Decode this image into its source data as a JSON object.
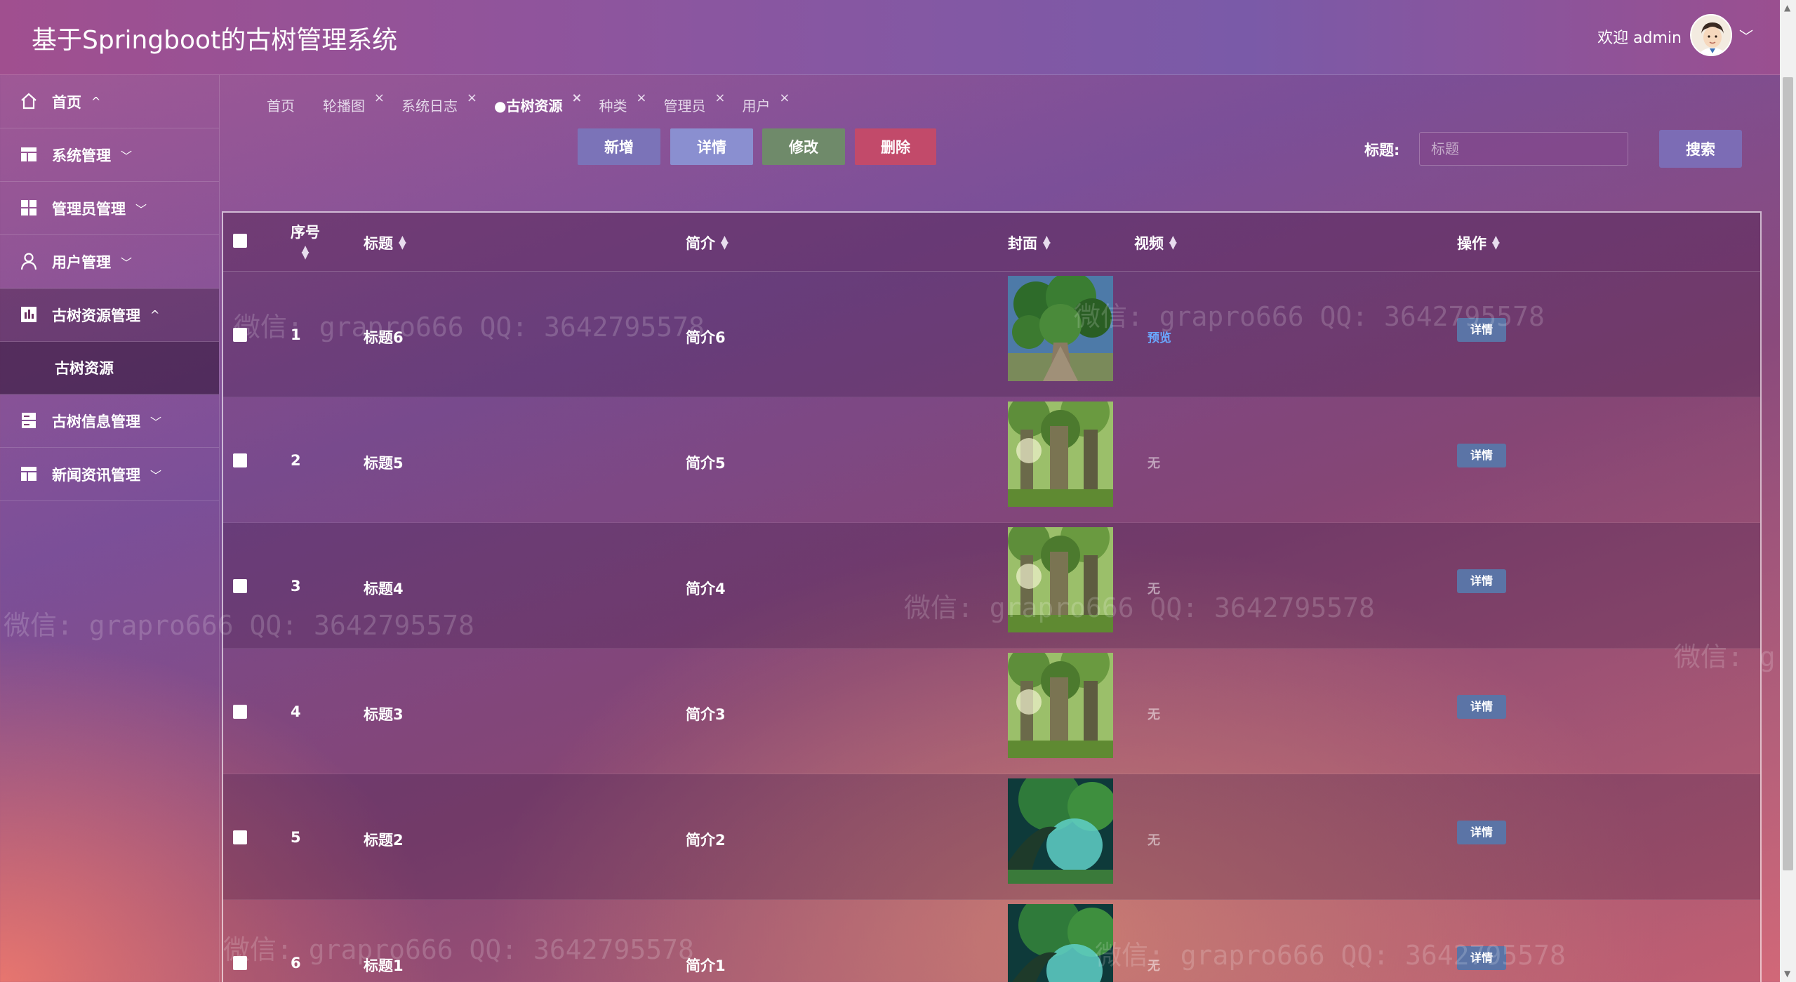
{
  "header": {
    "title": "基于Springboot的古树管理系统",
    "welcome": "欢迎 admin",
    "menu_arrow": "﹀"
  },
  "sidebar": {
    "items": [
      {
        "label": "首页",
        "icon": "home-icon",
        "arrow": "^"
      },
      {
        "label": "系统管理",
        "icon": "table-icon",
        "arrow": "﹀"
      },
      {
        "label": "管理员管理",
        "icon": "grid-icon",
        "arrow": "﹀"
      },
      {
        "label": "用户管理",
        "icon": "user-icon",
        "arrow": "﹀"
      },
      {
        "label": "古树资源管理",
        "icon": "chart-icon",
        "arrow": "^"
      },
      {
        "label": "古树信息管理",
        "icon": "server-icon",
        "arrow": "﹀"
      },
      {
        "label": "新闻资讯管理",
        "icon": "table-icon",
        "arrow": "﹀"
      }
    ],
    "subitem": "古树资源"
  },
  "tabs": [
    {
      "label": "首页",
      "closable": false
    },
    {
      "label": "轮播图",
      "closable": true
    },
    {
      "label": "系统日志",
      "closable": true
    },
    {
      "label": "●古树资源",
      "closable": true,
      "current": true
    },
    {
      "label": "种类",
      "closable": true
    },
    {
      "label": "管理员",
      "closable": true
    },
    {
      "label": "用户",
      "closable": true
    }
  ],
  "tab_close": "×",
  "toolbar": {
    "add": "新增",
    "detail": "详情",
    "edit": "修改",
    "delete": "删除",
    "colors": {
      "add": "#7b73b8",
      "detail": "#8a8fd0",
      "edit": "#6f8a6a",
      "delete": "#c24a6a"
    }
  },
  "search": {
    "label": "标题:",
    "placeholder": "标题",
    "button": "搜索"
  },
  "table": {
    "headers": {
      "index": "序号",
      "title": "标题",
      "intro": "简介",
      "cover": "封面",
      "video": "视频",
      "action": "操作"
    },
    "rows": [
      {
        "index": "1",
        "title": "标题6",
        "intro": "简介6",
        "video": "预览",
        "has_video": true,
        "action": "详情",
        "cover": "tree-a"
      },
      {
        "index": "2",
        "title": "标题5",
        "intro": "简介5",
        "video": "无",
        "has_video": false,
        "action": "详情",
        "cover": "tree-b"
      },
      {
        "index": "3",
        "title": "标题4",
        "intro": "简介4",
        "video": "无",
        "has_video": false,
        "action": "详情",
        "cover": "tree-b"
      },
      {
        "index": "4",
        "title": "标题3",
        "intro": "简介3",
        "video": "无",
        "has_video": false,
        "action": "详情",
        "cover": "tree-b"
      },
      {
        "index": "5",
        "title": "标题2",
        "intro": "简介2",
        "video": "无",
        "has_video": false,
        "action": "详情",
        "cover": "tree-c"
      },
      {
        "index": "6",
        "title": "标题1",
        "intro": "简介1",
        "video": "无",
        "has_video": false,
        "action": "详情",
        "cover": "tree-c"
      }
    ]
  },
  "watermark": "微信: grapro666 QQ: 3642795578"
}
